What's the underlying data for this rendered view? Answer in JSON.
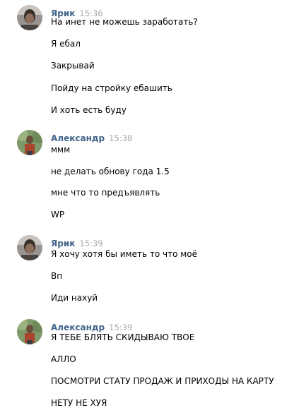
{
  "groups": [
    {
      "author": "Ярик",
      "time": "15:36",
      "avatar": "avatar-yarik",
      "messages": [
        "На инет не можешь заработать?",
        "Я ебал",
        "Закрывай",
        "Пойду на стройку ебашить",
        "И хоть есть буду"
      ]
    },
    {
      "author": "Александр",
      "time": "15:38",
      "avatar": "avatar-alexandr",
      "messages": [
        "ммм",
        "не делать обнову года 1.5",
        "мне что то предъявлять",
        "WP"
      ]
    },
    {
      "author": "Ярик",
      "time": "15:39",
      "avatar": "avatar-yarik",
      "messages": [
        "Я хочу хотя бы иметь то что моё",
        "Вп",
        "Иди нахуй"
      ]
    },
    {
      "author": "Александр",
      "time": "15:39",
      "avatar": "avatar-alexandr",
      "messages": [
        "Я ТЕБЕ БЛЯТЬ СКИДЫВАЮ ТВОЕ",
        "АЛЛО",
        "ПОСМОТРИ СТАТУ ПРОДАЖ И ПРИХОДЫ НА КАРТУ",
        "НЕТУ НЕ ХУЯ"
      ]
    }
  ],
  "colors": {
    "author": "#42648b",
    "time": "#a4a9b0",
    "text": "#000000",
    "background": "#ffffff"
  }
}
